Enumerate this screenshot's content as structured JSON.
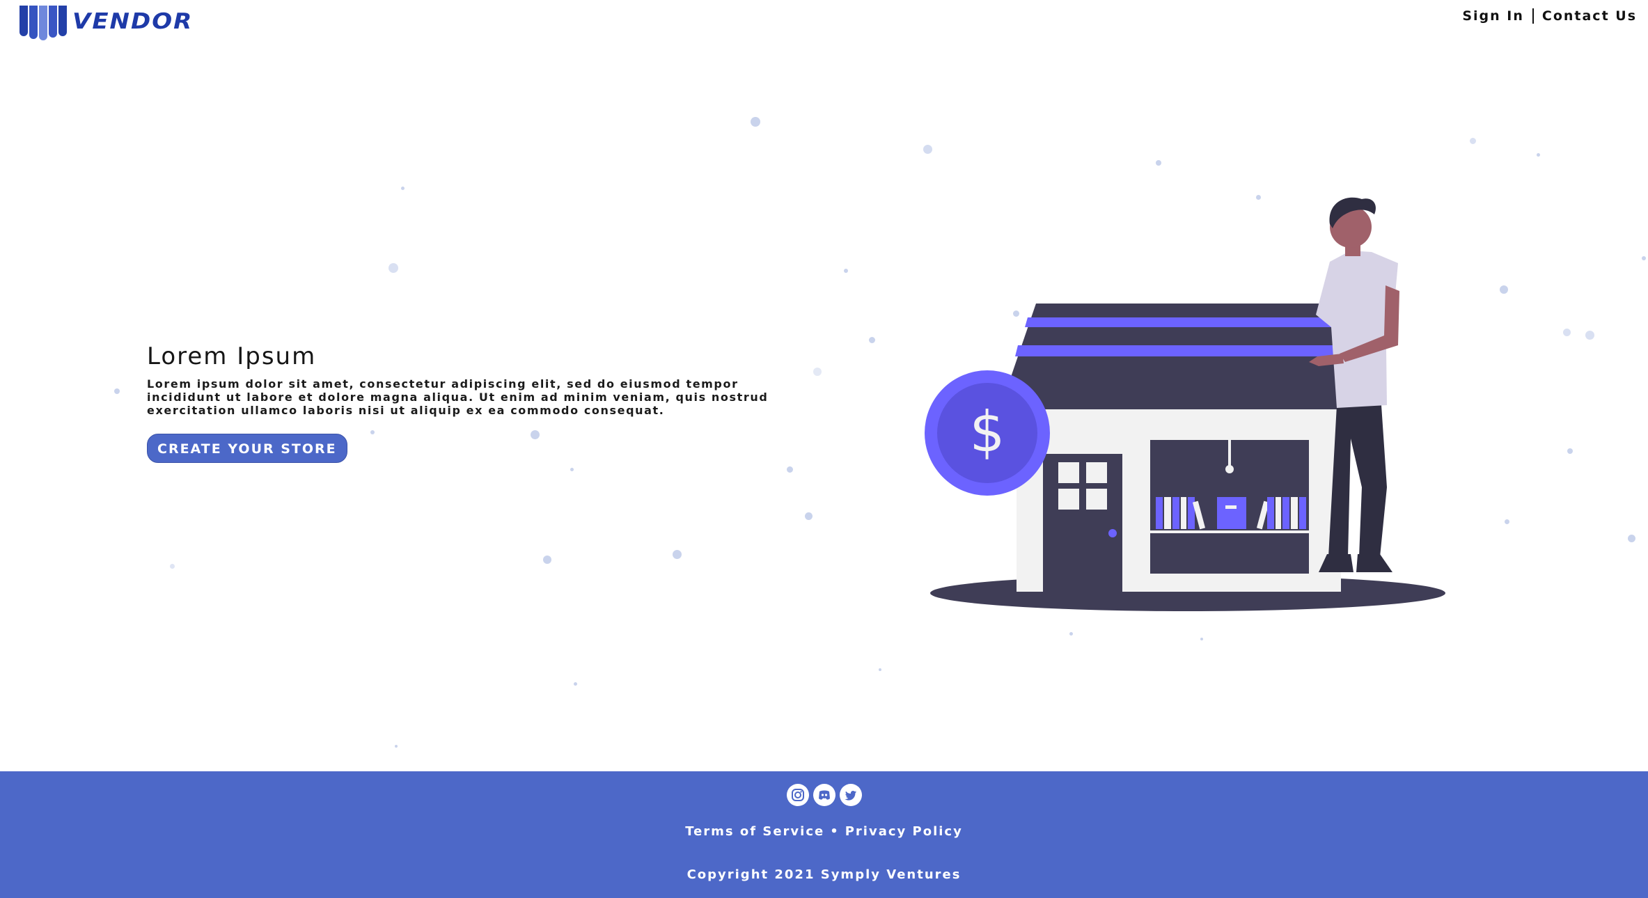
{
  "brand": {
    "name": "VENDOR",
    "color": "#1e3aa8",
    "bar_colors": [
      "#2340a8",
      "#3554c0",
      "#5b76d4",
      "#2f4bb6"
    ]
  },
  "nav": {
    "sign_in": "Sign In",
    "contact": "Contact Us"
  },
  "hero": {
    "title": "Lorem Ipsum",
    "body": "Lorem ipsum dolor sit amet, consectetur adipiscing elit, sed do eiusmod tempor incididunt ut labore et dolore magna aliqua. Ut enim ad minim veniam, quis nostrud exercitation ullamco laboris nisi ut aliquip ex ea commodo consequat.",
    "cta_label": "CREATE YOUR STORE"
  },
  "illustration": {
    "coin_symbol": "$",
    "accent": "#6c63ff",
    "dark": "#3f3d56",
    "skin": "#a0616a",
    "shirt": "#d7d3e6"
  },
  "footer": {
    "social_icons": [
      "instagram-icon",
      "discord-icon",
      "twitter-icon"
    ],
    "terms": "Terms of Service",
    "separator": "•",
    "privacy": "Privacy Policy",
    "copyright": "Copyright 2021 Symply Ventures",
    "background": "#4d68c8"
  }
}
